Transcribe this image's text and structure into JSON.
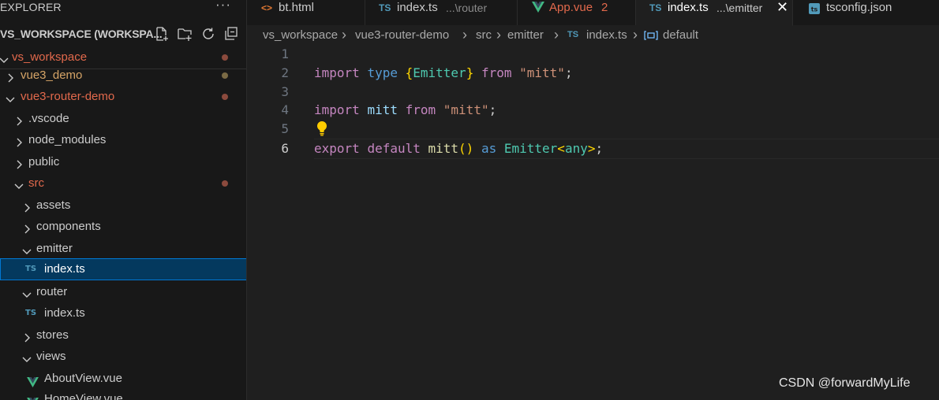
{
  "sidebar": {
    "header_title": "EXPLORER",
    "more_label": "···",
    "workspace_title": "VS_WORKSPACE (WORKSPA...",
    "items": [
      {
        "label": "vs_workspace",
        "dot_color": "#8b4a3d"
      },
      {
        "label": "vue3_demo",
        "dot_color": "#7a6a45"
      },
      {
        "label": "vue3-router-demo",
        "dot_color": "#8b4a3d"
      },
      {
        "label": ".vscode"
      },
      {
        "label": "node_modules"
      },
      {
        "label": "public"
      },
      {
        "label": "src",
        "dot_color": "#8b4a3d"
      },
      {
        "label": "assets"
      },
      {
        "label": "components"
      },
      {
        "label": "emitter"
      },
      {
        "label": "index.ts",
        "icon_text": "TS"
      },
      {
        "label": "router"
      },
      {
        "label": "index.ts",
        "icon_text": "TS"
      },
      {
        "label": "stores"
      },
      {
        "label": "views"
      },
      {
        "label": "AboutView.vue"
      },
      {
        "label": "HomeView.vue"
      }
    ]
  },
  "tabs": [
    {
      "icon": "<>",
      "name": "bt.html"
    },
    {
      "icon": "TS",
      "name": "index.ts",
      "desc": "...\\router"
    },
    {
      "name": "App.vue",
      "badge": "2"
    },
    {
      "icon": "TS",
      "name": "index.ts",
      "desc": "...\\emitter",
      "close": "✕"
    },
    {
      "name": "tsconfig.json"
    }
  ],
  "breadcrumb": {
    "parts": [
      "vs_workspace",
      "vue3-router-demo",
      "src",
      "emitter",
      "index.ts",
      "default"
    ],
    "ts_icon": "TS",
    "sep": "›"
  },
  "editor": {
    "line_numbers": [
      "1",
      "2",
      "3",
      "4",
      "5",
      "6"
    ],
    "current_line": "6",
    "line2": {
      "t1": "import",
      "t2": "type",
      "t3": "{",
      "t4": "Emitter",
      "t5": "}",
      "t6": "from",
      "t7": "\"mitt\"",
      "t8": ";"
    },
    "line4": {
      "t1": "import",
      "t2": "mitt",
      "t3": "from",
      "t4": "\"mitt\"",
      "t5": ";"
    },
    "line6": {
      "t1": "export",
      "t2": "default",
      "t3": "mitt",
      "t4": "()",
      "t5": "as",
      "t6": "Emitter",
      "t7": "<",
      "t8": "any",
      "t9": ">",
      "t10": ";"
    }
  },
  "watermark": "CSDN @forwardMyLife"
}
